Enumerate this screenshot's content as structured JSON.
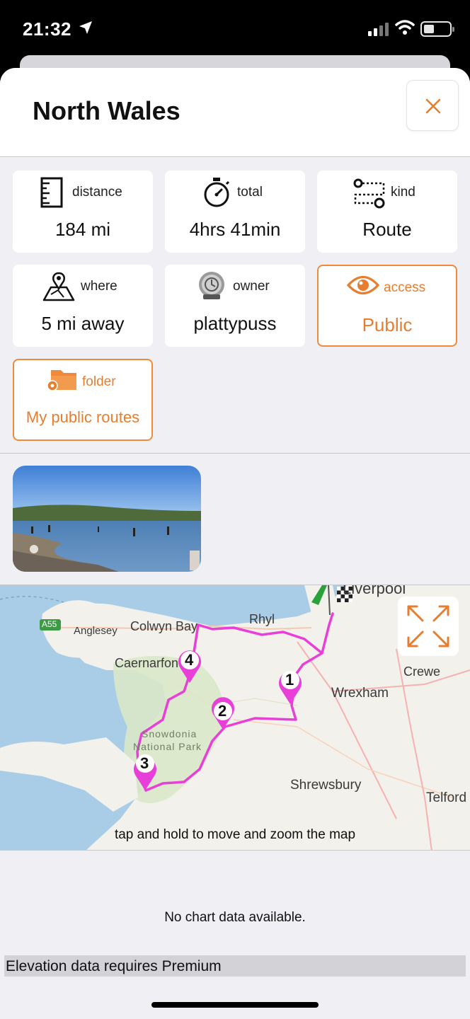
{
  "status_bar": {
    "time": "21:32"
  },
  "header": {
    "title": "North Wales"
  },
  "stats": [
    {
      "label": "distance",
      "value": "184 mi",
      "icon": "ruler-icon"
    },
    {
      "label": "total",
      "value": "4hrs 41min",
      "icon": "stopwatch-icon"
    },
    {
      "label": "kind",
      "value": "Route",
      "icon": "route-kind-icon"
    },
    {
      "label": "where",
      "value": "5 mi away",
      "icon": "map-location-icon"
    },
    {
      "label": "owner",
      "value": "plattypuss",
      "icon": "owner-badge-icon"
    },
    {
      "label": "access",
      "value": "Public",
      "icon": "eye-icon"
    },
    {
      "label": "folder",
      "value": "My public routes",
      "icon": "folder-gear-icon"
    }
  ],
  "map": {
    "places": [
      "Anglesey",
      "Colwyn Bay",
      "Rhyl",
      "Liverpool",
      "Caernarfon",
      "Crewe",
      "Wrexham",
      "Snowdonia",
      "National Park",
      "Shrewsbury",
      "Telford",
      "A55"
    ],
    "waypoints": [
      "1",
      "2",
      "3",
      "4"
    ],
    "hint": "tap and hold to move and zoom the map",
    "route_color": "#e93fd9"
  },
  "elevation": {
    "no_data": "No chart data available.",
    "premium_notice": "Elevation data requires Premium"
  },
  "colors": {
    "accent": "#e77d2f",
    "route": "#e93fd9"
  }
}
